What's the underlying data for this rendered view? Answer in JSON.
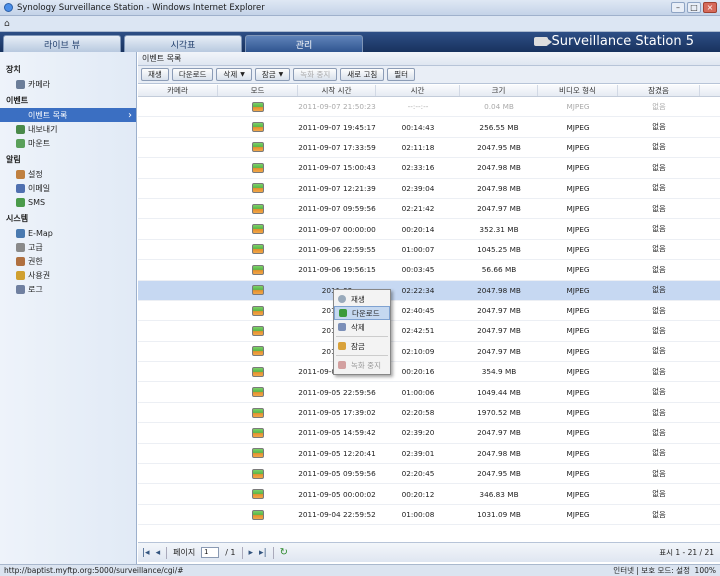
{
  "window": {
    "title": "Synology Surveillance Station - Windows Internet Explorer"
  },
  "nav": {
    "tabs": [
      {
        "label": "라이브 뷰"
      },
      {
        "label": "시각표"
      },
      {
        "label": "관리"
      }
    ],
    "brand": "Surveillance Station 5"
  },
  "sidebar": {
    "sections": [
      {
        "title": "장치",
        "items": [
          {
            "label": "카메라",
            "icon": "camera-icon"
          }
        ]
      },
      {
        "title": "이벤트",
        "items": [
          {
            "label": "이벤트 목록",
            "icon": "event-list-icon"
          },
          {
            "label": "내보내기",
            "icon": "export-icon"
          },
          {
            "label": "마운트",
            "icon": "mount-icon"
          }
        ]
      },
      {
        "title": "알림",
        "items": [
          {
            "label": "설정",
            "icon": "settings-icon"
          },
          {
            "label": "이메일",
            "icon": "email-icon"
          },
          {
            "label": "SMS",
            "icon": "sms-icon"
          }
        ]
      },
      {
        "title": "시스템",
        "items": [
          {
            "label": "E-Map",
            "icon": "emap-icon"
          },
          {
            "label": "고급",
            "icon": "advanced-icon"
          },
          {
            "label": "권한",
            "icon": "privilege-icon"
          },
          {
            "label": "사용권",
            "icon": "license-icon"
          },
          {
            "label": "로그",
            "icon": "log-icon"
          }
        ]
      }
    ]
  },
  "panel": {
    "title": "이벤트 목록"
  },
  "toolbar": {
    "play": "재생",
    "download": "다운로드",
    "delete": "삭제",
    "lock": "잠금",
    "stop_recording": "녹화 중지",
    "refresh": "새로 고침",
    "filter": "필터"
  },
  "table": {
    "columns": [
      "카메라",
      "모드",
      "시작 시간",
      "시간",
      "크기",
      "비디오 형식",
      "잠겼음"
    ],
    "rows": [
      {
        "camera": "",
        "start": "2011-09-07 21:50:23",
        "duration": "--:--:--",
        "size": "0.04 MB",
        "format": "MJPEG",
        "locked": "없음"
      },
      {
        "camera": "",
        "start": "2011-09-07 19:45:17",
        "duration": "00:14:43",
        "size": "256.55 MB",
        "format": "MJPEG",
        "locked": "없음"
      },
      {
        "camera": "",
        "start": "2011-09-07 17:33:59",
        "duration": "02:11:18",
        "size": "2047.95 MB",
        "format": "MJPEG",
        "locked": "없음"
      },
      {
        "camera": "",
        "start": "2011-09-07 15:00:43",
        "duration": "02:33:16",
        "size": "2047.98 MB",
        "format": "MJPEG",
        "locked": "없음"
      },
      {
        "camera": "",
        "start": "2011-09-07 12:21:39",
        "duration": "02:39:04",
        "size": "2047.98 MB",
        "format": "MJPEG",
        "locked": "없음"
      },
      {
        "camera": "",
        "start": "2011-09-07 09:59:56",
        "duration": "02:21:42",
        "size": "2047.97 MB",
        "format": "MJPEG",
        "locked": "없음"
      },
      {
        "camera": "",
        "start": "2011-09-07 00:00:00",
        "duration": "00:20:14",
        "size": "352.31 MB",
        "format": "MJPEG",
        "locked": "없음"
      },
      {
        "camera": "",
        "start": "2011-09-06 22:59:55",
        "duration": "01:00:07",
        "size": "1045.25 MB",
        "format": "MJPEG",
        "locked": "없음"
      },
      {
        "camera": "",
        "start": "2011-09-06 19:56:15",
        "duration": "00:03:45",
        "size": "56.66 MB",
        "format": "MJPEG",
        "locked": "없음"
      },
      {
        "camera": "",
        "start": "2011-09",
        "duration": "02:22:34",
        "size": "2047.98 MB",
        "format": "MJPEG",
        "locked": "없음"
      },
      {
        "camera": "",
        "start": "2011-09",
        "duration": "02:40:45",
        "size": "2047.97 MB",
        "format": "MJPEG",
        "locked": "없음"
      },
      {
        "camera": "",
        "start": "2011-09",
        "duration": "02:42:51",
        "size": "2047.97 MB",
        "format": "MJPEG",
        "locked": "없음"
      },
      {
        "camera": "",
        "start": "2011-09",
        "duration": "02:10:09",
        "size": "2047.97 MB",
        "format": "MJPEG",
        "locked": "없음"
      },
      {
        "camera": "",
        "start": "2011-09-05 23:59:59",
        "duration": "00:20:16",
        "size": "354.9 MB",
        "format": "MJPEG",
        "locked": "없음"
      },
      {
        "camera": "",
        "start": "2011-09-05 22:59:56",
        "duration": "01:00:06",
        "size": "1049.44 MB",
        "format": "MJPEG",
        "locked": "없음"
      },
      {
        "camera": "",
        "start": "2011-09-05 17:39:02",
        "duration": "02:20:58",
        "size": "1970.52 MB",
        "format": "MJPEG",
        "locked": "없음"
      },
      {
        "camera": "",
        "start": "2011-09-05 14:59:42",
        "duration": "02:39:20",
        "size": "2047.97 MB",
        "format": "MJPEG",
        "locked": "없음"
      },
      {
        "camera": "",
        "start": "2011-09-05 12:20:41",
        "duration": "02:39:01",
        "size": "2047.98 MB",
        "format": "MJPEG",
        "locked": "없음"
      },
      {
        "camera": "",
        "start": "2011-09-05 09:59:56",
        "duration": "02:20:45",
        "size": "2047.95 MB",
        "format": "MJPEG",
        "locked": "없음"
      },
      {
        "camera": "",
        "start": "2011-09-05 00:00:02",
        "duration": "00:20:12",
        "size": "346.83 MB",
        "format": "MJPEG",
        "locked": "없음"
      },
      {
        "camera": "",
        "start": "2011-09-04 22:59:52",
        "duration": "01:00:08",
        "size": "1031.09 MB",
        "format": "MJPEG",
        "locked": "없음"
      }
    ]
  },
  "context_menu": {
    "items": [
      {
        "label": "재생",
        "icon": "play-icon"
      },
      {
        "label": "다운로드",
        "icon": "download-icon"
      },
      {
        "label": "삭제",
        "icon": "delete-icon"
      },
      {
        "label": "잠금",
        "icon": "lock-icon"
      },
      {
        "label": "녹화 중지",
        "icon": "stop-recording-icon"
      }
    ]
  },
  "pager": {
    "page_label": "페이지",
    "page_value": "1",
    "page_of": "/ 1",
    "display": "표시 1 - 21 / 21"
  },
  "statusbar": {
    "url": "http://baptist.myftp.org:5000/surveillance/cgi/#",
    "zone": "인터넷 | 보호 모드: 설정",
    "zoom": "100%"
  },
  "colors": {
    "header": "#18325e",
    "selected": "#3b6fc2",
    "row_selected": "#c6d8f2"
  }
}
